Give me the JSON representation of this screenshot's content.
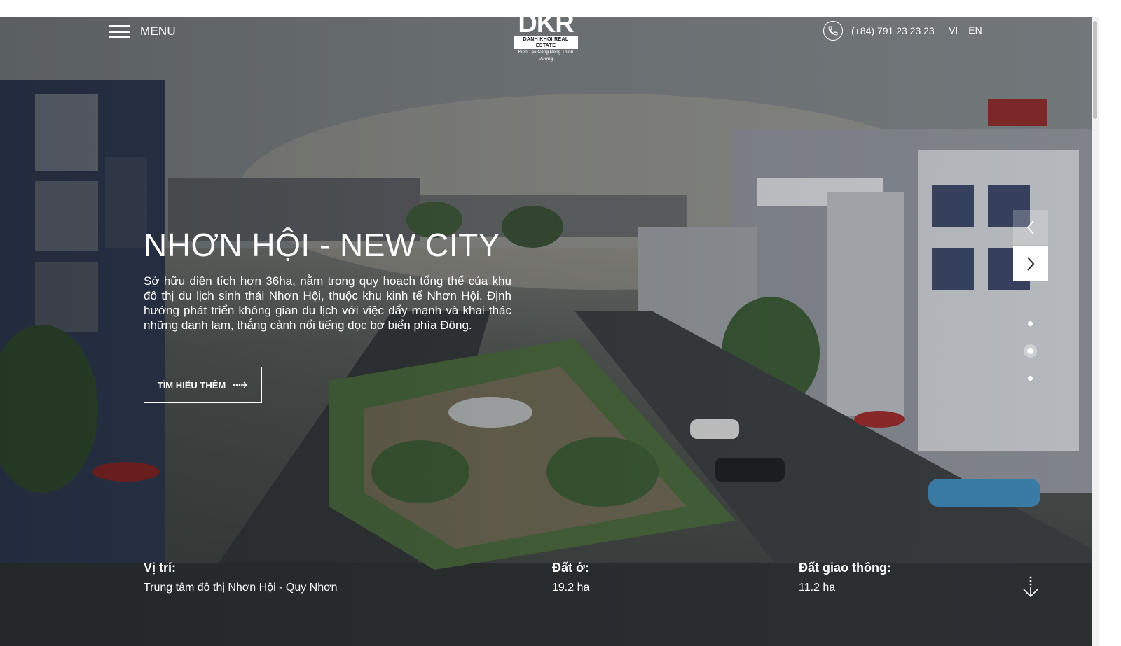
{
  "header": {
    "menu_label": "MENU",
    "logo": {
      "mark": "DKR",
      "name": "DANH KHOI REAL ESTATE",
      "tagline": "Kiến Tạo Cộng Đồng Thịnh Vượng"
    },
    "phone": "(+84) 791 23 23 23",
    "languages": [
      "VI",
      "EN"
    ]
  },
  "hero": {
    "title": "NHƠN HỘI - NEW CITY",
    "description": "Sở hữu diện tích hơn 36ha, nằm trong quy hoạch tổng thể của khu đô thị du lịch sinh thái Nhơn Hội, thuộc khu kinh tế Nhơn Hội. Định hướng phát triển không gian du lịch với việc đẩy mạnh và khai thác những danh lam, thắng cảnh nổi tiếng dọc bờ biển phía Đông.",
    "cta_label": "TÌM HIỂU THÊM",
    "slides": {
      "count": 3,
      "active": 2
    }
  },
  "facts": [
    {
      "label": "Vị trí:",
      "value": "Trung tâm đô thị Nhơn Hội - Quy Nhơn"
    },
    {
      "label": "Đất ở:",
      "value": "19.2 ha"
    },
    {
      "label": "Đất giao thông:",
      "value": "11.2 ha"
    }
  ],
  "icons": {
    "menu": "hamburger-icon",
    "phone": "phone-icon",
    "cta": "arrow-right-dotted-icon",
    "prev": "chevron-left-icon",
    "next": "chevron-right-icon",
    "scroll": "scroll-down-icon"
  }
}
